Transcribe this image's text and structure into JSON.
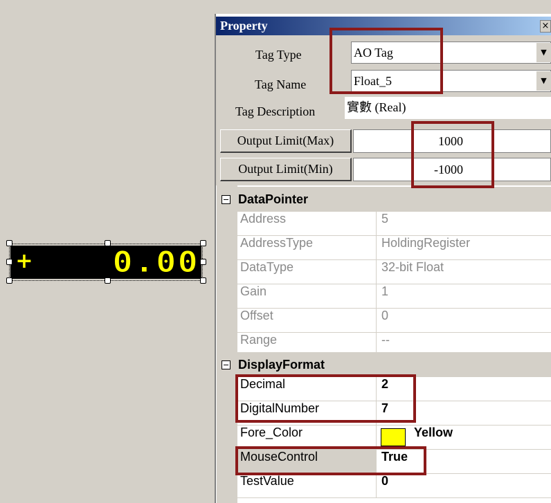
{
  "display_widget": {
    "sign": "+",
    "value": "0.00",
    "fore_color": "#ffff00",
    "back_color": "#000000"
  },
  "panel": {
    "title": "Property",
    "close_glyph": "×",
    "tag_type": {
      "label": "Tag Type",
      "value": "AO Tag"
    },
    "tag_name": {
      "label": "Tag Name",
      "value": "Float_5"
    },
    "tag_description": {
      "label": "Tag Description",
      "value": "實數 (Real)"
    },
    "output_max": {
      "label": "Output Limit(Max)",
      "value": "1000"
    },
    "output_min": {
      "label": "Output Limit(Min)",
      "value": "-1000"
    },
    "dropdown_glyph": "▼"
  },
  "grid": {
    "datapointer": {
      "label": "DataPointer",
      "rows": [
        {
          "name": "Address",
          "value": "5"
        },
        {
          "name": "AddressType",
          "value": "HoldingRegister"
        },
        {
          "name": "DataType",
          "value": "32-bit Float"
        },
        {
          "name": "Gain",
          "value": "1"
        },
        {
          "name": "Offset",
          "value": "0"
        },
        {
          "name": "Range",
          "value": "--"
        }
      ]
    },
    "displayformat": {
      "label": "DisplayFormat",
      "rows": [
        {
          "name": "Decimal",
          "value": "2"
        },
        {
          "name": "DigitalNumber",
          "value": "7"
        },
        {
          "name": "Fore_Color",
          "value": "Yellow",
          "color": "#ffff00"
        },
        {
          "name": "MouseControl",
          "value": "True"
        },
        {
          "name": "TestValue",
          "value": "0"
        }
      ]
    }
  },
  "colors": {
    "highlight": "#8b1a1a",
    "title_gradient_start": "#0a246a",
    "title_gradient_end": "#a6caf0",
    "window_bg": "#d4d0c8"
  }
}
